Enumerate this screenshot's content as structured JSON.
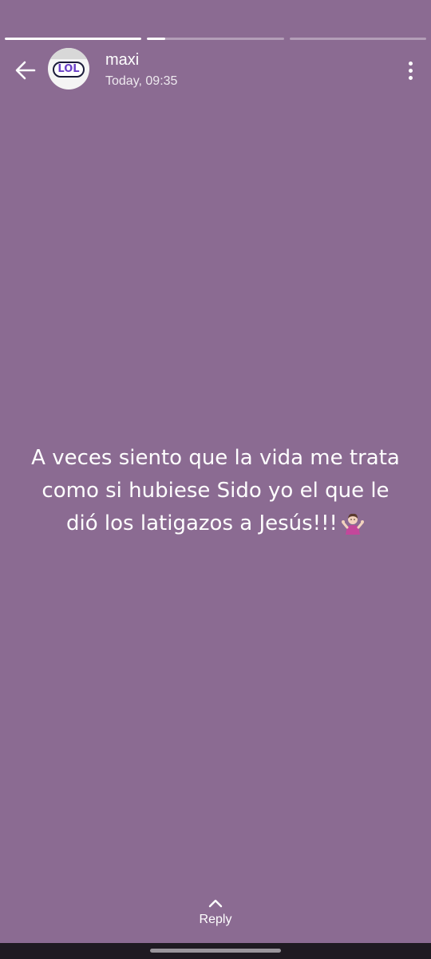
{
  "story": {
    "progress": [
      1.0,
      0.13,
      0.0
    ],
    "background_color": "#8b6b92"
  },
  "header": {
    "back_icon": "arrow-left-icon",
    "avatar_text": "LOL",
    "user_name": "maxi",
    "timestamp": "Today, 09:35",
    "more_icon": "more-vertical-icon"
  },
  "content": {
    "line1": "A veces siento que la vida me trata",
    "line2": "como si hubiese Sido yo el que le",
    "line3": "dió los latigazos a Jesús!!!",
    "emoji": "person-shrugging-icon"
  },
  "footer": {
    "reply_icon": "chevron-up-icon",
    "reply_label": "Reply"
  }
}
